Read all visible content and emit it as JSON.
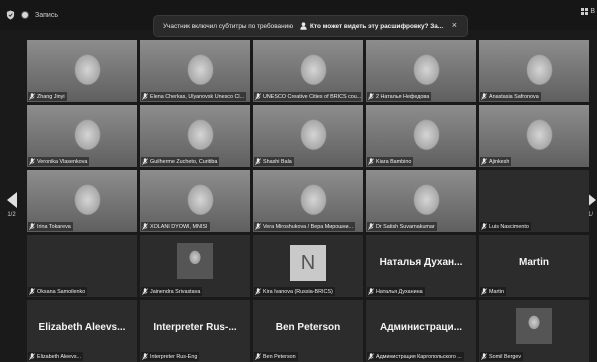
{
  "topbar": {
    "record_label": "Запись",
    "view_label": "В"
  },
  "notice": {
    "message": "Участник включил субтитры по требованию",
    "link": "Кто может видеть эту расшифровку? За...",
    "close": "×"
  },
  "pager": {
    "left_label": "1/2",
    "right_label": "1/"
  },
  "tiles": [
    {
      "name": "Zhang Jinyi",
      "kind": "video"
    },
    {
      "name": "Elena Cherkas, Ulyanovsk Unesco Cl...",
      "kind": "video"
    },
    {
      "name": "UNESCO Creative Cities of BRICS cou...",
      "kind": "video"
    },
    {
      "name": "2 Наталья Нефедова",
      "kind": "video"
    },
    {
      "name": "Anastasia Safronova",
      "kind": "video"
    },
    {
      "name": "Veronika Vlasenkova",
      "kind": "video"
    },
    {
      "name": "Guilherme Zucheto, Curitiba",
      "kind": "video"
    },
    {
      "name": "Shashi Bala",
      "kind": "video"
    },
    {
      "name": "Kiara Bambino",
      "kind": "video"
    },
    {
      "name": "Ajinkesh",
      "kind": "video"
    },
    {
      "name": "Irina Tokareva",
      "kind": "video"
    },
    {
      "name": "XOLANI DYOWI, MNISI",
      "kind": "video"
    },
    {
      "name": "Vera Miroshukova / Вера Мирошни...",
      "kind": "video",
      "active": true
    },
    {
      "name": "Dr Satish Suvarnakumar",
      "kind": "video"
    },
    {
      "name": "Luis Nascimento",
      "kind": "empty"
    },
    {
      "name": "Oksana Samoilenko",
      "kind": "empty"
    },
    {
      "name": "Jainendra Srivastava",
      "kind": "thumb"
    },
    {
      "name": "Kira Ivanova (Russia-BRICS)",
      "kind": "letter",
      "letter": "N"
    },
    {
      "name": "Наталья Духанина",
      "kind": "text",
      "big": "Наталья Духан..."
    },
    {
      "name": "Martin",
      "kind": "text",
      "big": "Martin"
    },
    {
      "name": "Elizabeth Aleevs...",
      "kind": "text",
      "big": "Elizabeth Aleevs..."
    },
    {
      "name": "Interpreter Rus-Eng",
      "kind": "text",
      "big": "Interpreter Rus-..."
    },
    {
      "name": "Ben Peterson",
      "kind": "text",
      "big": "Ben Peterson"
    },
    {
      "name": "Администрация Каргопольского ...",
      "kind": "text",
      "big": "Администраци..."
    },
    {
      "name": "Somil Bergev",
      "kind": "thumb"
    }
  ]
}
